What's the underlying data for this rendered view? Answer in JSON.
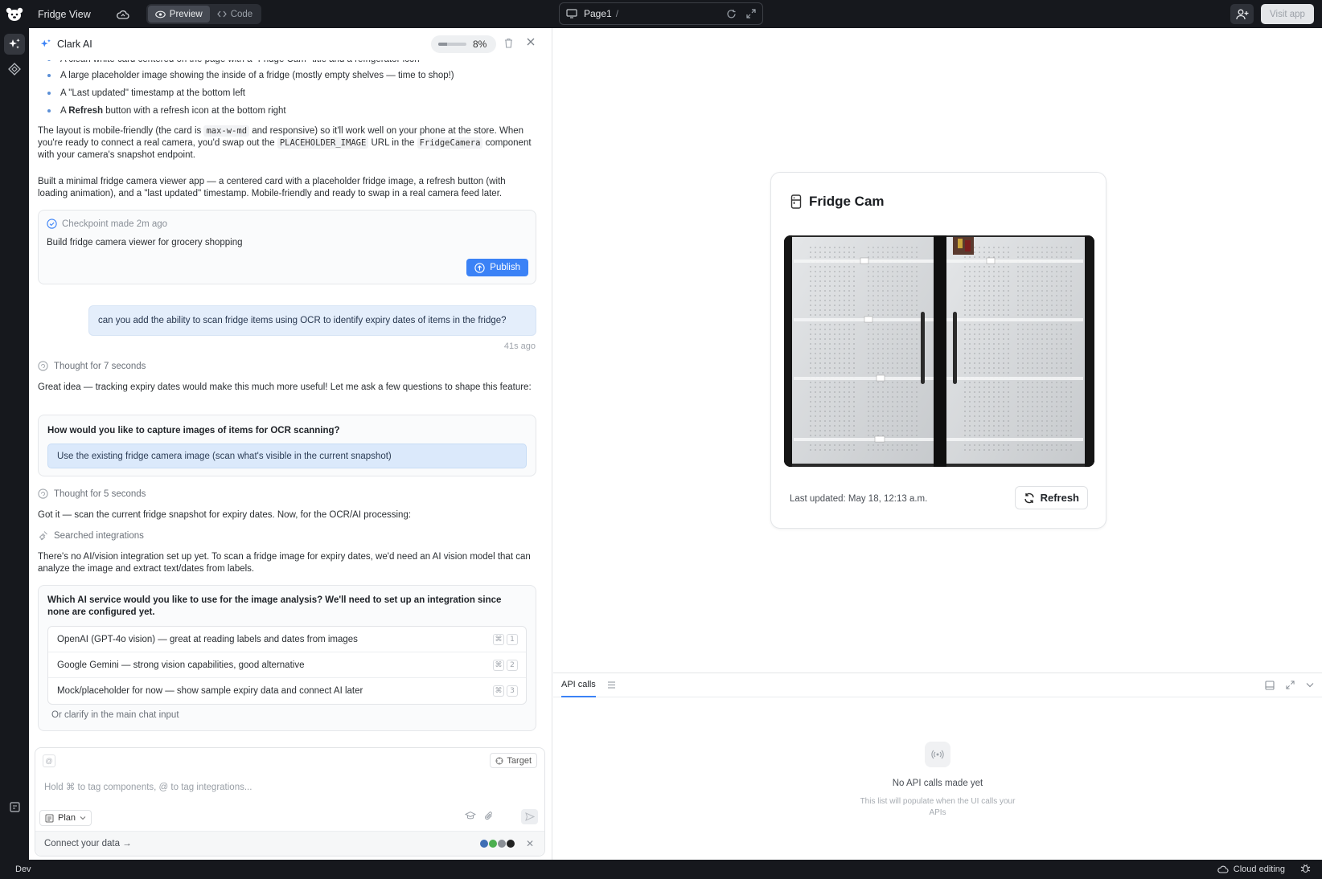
{
  "topbar": {
    "app_title": "Fridge View",
    "tabs": [
      {
        "label": "Preview",
        "active": true
      },
      {
        "label": "Code",
        "active": false
      }
    ],
    "url": {
      "page": "Page1",
      "path": "/"
    },
    "visit_label": "Visit app"
  },
  "chat": {
    "title": "Clark AI",
    "usage_percent": 8,
    "usage_label": "8%",
    "cut_line": "A clean white card centered on the page with a \"Fridge Cam\" title and a refrigerator icon",
    "bullets": [
      "A large placeholder image showing the inside of a fridge (mostly empty shelves — time to shop!)",
      "A \"Last updated\" timestamp at the bottom left"
    ],
    "bullet_refresh_pre": "A ",
    "bullet_refresh_bold": "Refresh",
    "bullet_refresh_post": " button with a refresh icon at the bottom right",
    "layout_p1": "The layout is mobile-friendly (the card is ",
    "layout_code1": "max-w-md",
    "layout_p2": " and responsive) so it'll work well on your phone at the store. When you're ready to connect a real camera, you'd swap out the ",
    "layout_code2": "PLACEHOLDER_IMAGE",
    "layout_p3": " URL in the ",
    "layout_code3": "FridgeCamera",
    "layout_p4": " component with your camera's snapshot endpoint.",
    "summary": "Built a minimal fridge camera viewer app — a centered card with a placeholder fridge image, a refresh button (with loading animation), and a \"last updated\" timestamp. Mobile-friendly and ready to swap in a real camera feed later.",
    "checkpoint": {
      "label": "Checkpoint made 2m ago",
      "text": "Build fridge camera viewer for grocery shopping",
      "publish": "Publish"
    },
    "user_message": "can you add the ability to scan fridge items using OCR to identify expiry dates of items in the fridge?",
    "user_time": "41s ago",
    "thought1": "Thought for 7 seconds",
    "reply1": "Great idea — tracking expiry dates would make this much more useful! Let me ask a few questions to shape this feature:",
    "q1": {
      "title": "How would you like to capture images of items for OCR scanning?",
      "selected": "Use the existing fridge camera image (scan what's visible in the current snapshot)"
    },
    "thought2": "Thought for 5 seconds",
    "reply2": "Got it — scan the current fridge snapshot for expiry dates. Now, for the OCR/AI processing:",
    "searched": "Searched integrations",
    "reply3": "There's no AI/vision integration set up yet. To scan a fridge image for expiry dates, we'd need an AI vision model that can analyze the image and extract text/dates from labels.",
    "q2": {
      "title": "Which AI service would you like to use for the image analysis? We'll need to set up an integration since none are configured yet.",
      "options": [
        {
          "label": "OpenAI (GPT-4o vision) — great at reading labels and dates from images",
          "key": "⌘",
          "num": "1"
        },
        {
          "label": "Google Gemini — strong vision capabilities, good alternative",
          "key": "⌘",
          "num": "2"
        },
        {
          "label": "Mock/placeholder for now — show sample expiry data and connect AI later",
          "key": "⌘",
          "num": "3"
        }
      ],
      "clarify": "Or clarify in the main chat input"
    },
    "composer": {
      "at": "@",
      "target": "Target",
      "placeholder": "Hold ⌘ to tag components, @ to tag integrations...",
      "plan": "Plan",
      "connect": "Connect your data →"
    }
  },
  "preview": {
    "title": "Fridge Cam",
    "updated": "Last updated: May 18, 12:13 a.m.",
    "refresh": "Refresh"
  },
  "devpanel": {
    "tab": "API calls",
    "empty_title": "No API calls made yet",
    "empty_sub": "This list will populate when the UI calls your APIs"
  },
  "statusbar": {
    "mode": "Dev",
    "cloud": "Cloud editing"
  },
  "colors": {
    "accent": "#3b82f6",
    "chrome": "#16181d",
    "selected_option": "#dbe9fb"
  }
}
